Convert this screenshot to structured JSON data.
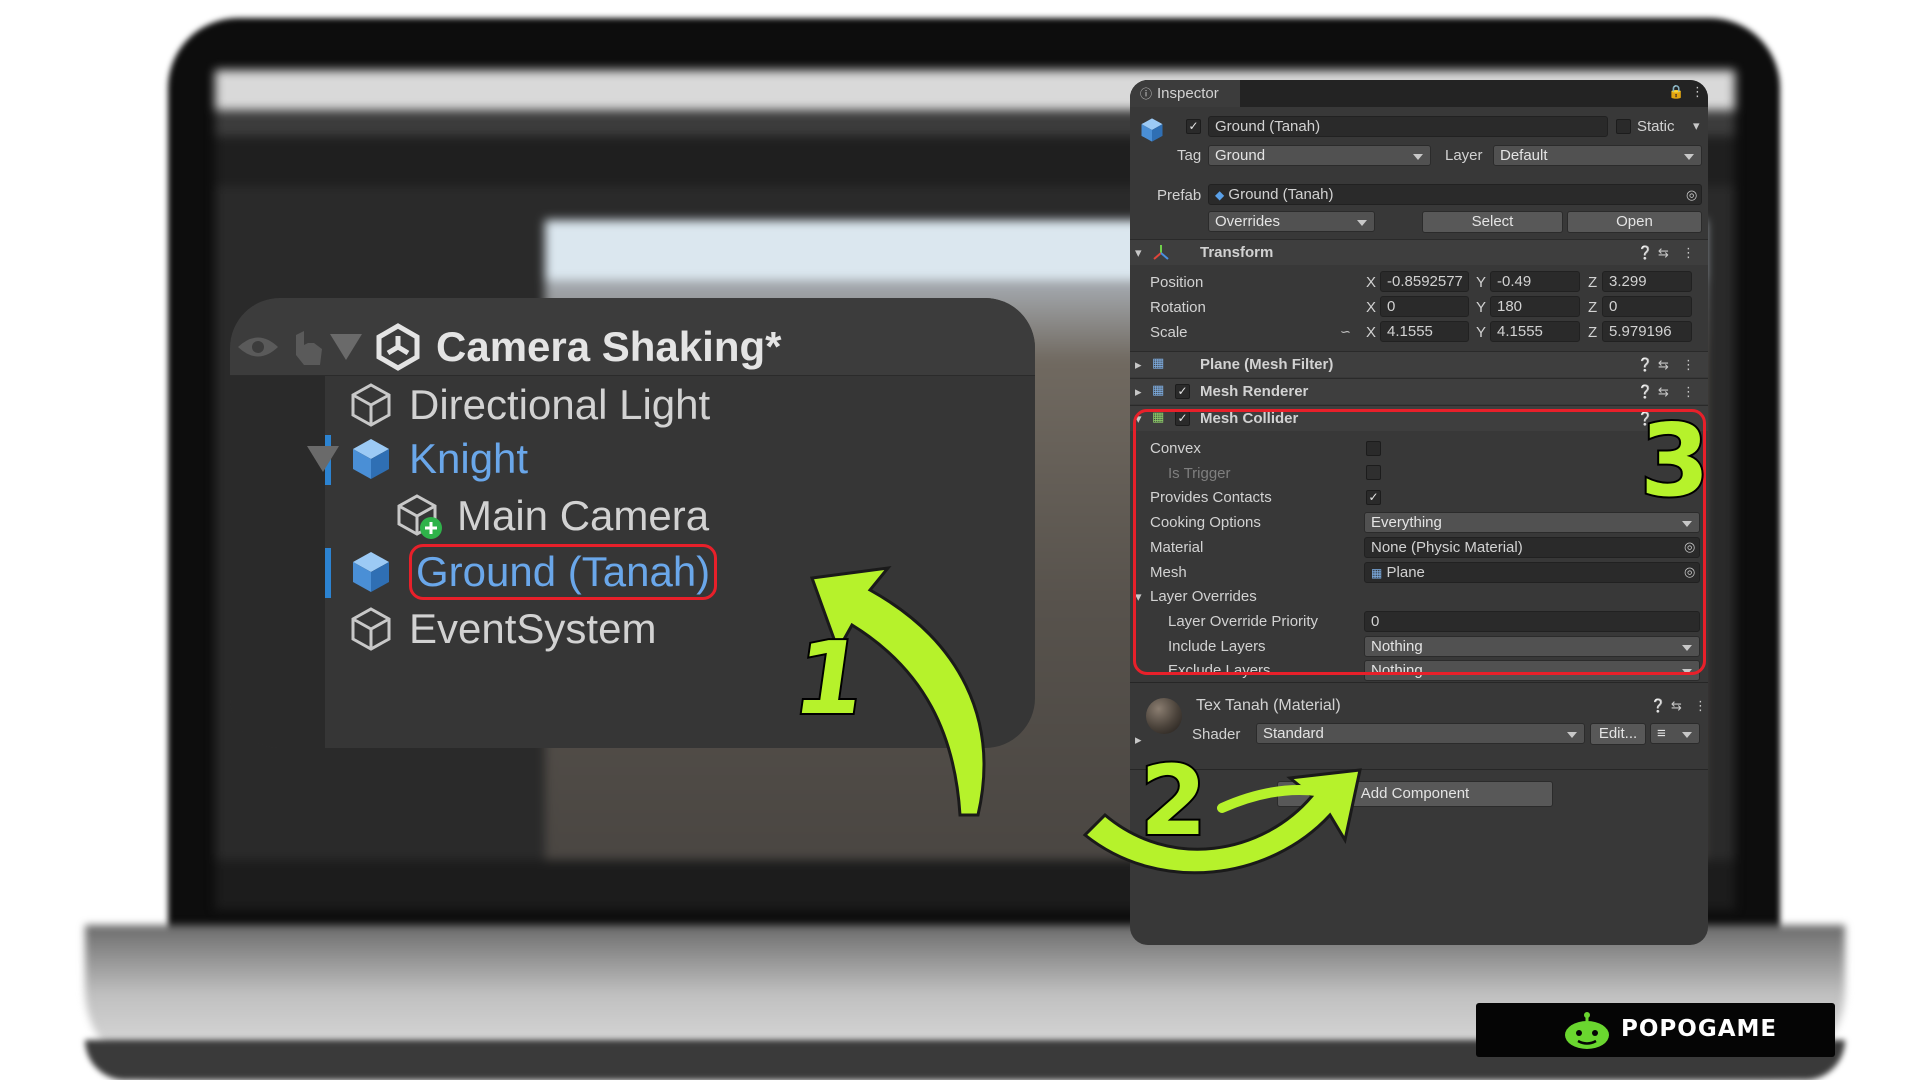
{
  "hierarchy": {
    "scene_name": "Camera Shaking*",
    "items": [
      {
        "label": "Directional Light"
      },
      {
        "label": "Knight"
      },
      {
        "label": "Main Camera"
      },
      {
        "label": "Ground (Tanah)"
      },
      {
        "label": "EventSystem"
      }
    ]
  },
  "inspector": {
    "tab_label": "Inspector",
    "object_name": "Ground (Tanah)",
    "static_label": "Static",
    "tag_label": "Tag",
    "tag_value": "Ground",
    "layer_label": "Layer",
    "layer_value": "Default",
    "prefab_label": "Prefab",
    "prefab_value": "Ground (Tanah)",
    "overrides_label": "Overrides",
    "select_label": "Select",
    "open_label": "Open",
    "transform": {
      "title": "Transform",
      "position_label": "Position",
      "rotation_label": "Rotation",
      "scale_label": "Scale",
      "position": {
        "x": "-0.8592577",
        "y": "-0.49",
        "z": "3.299"
      },
      "rotation": {
        "x": "0",
        "y": "180",
        "z": "0"
      },
      "scale": {
        "x": "4.1555",
        "y": "4.1555",
        "z": "5.979196"
      }
    },
    "mesh_filter_title": "Plane (Mesh Filter)",
    "mesh_renderer_title": "Mesh Renderer",
    "mesh_collider": {
      "title": "Mesh Collider",
      "convex_label": "Convex",
      "is_trigger_label": "Is Trigger",
      "provides_contacts_label": "Provides Contacts",
      "cooking_options_label": "Cooking Options",
      "cooking_options_value": "Everything",
      "material_label": "Material",
      "material_value": "None (Physic Material)",
      "mesh_label": "Mesh",
      "mesh_value": "Plane",
      "layer_overrides_label": "Layer Overrides",
      "layer_override_priority_label": "Layer Override Priority",
      "layer_override_priority_value": "0",
      "include_layers_label": "Include Layers",
      "include_layers_value": "Nothing",
      "exclude_layers_label": "Exclude Layers",
      "exclude_layers_value": "Nothing"
    },
    "material": {
      "title": "Tex Tanah (Material)",
      "shader_label": "Shader",
      "shader_value": "Standard",
      "edit_label": "Edit..."
    },
    "add_component_label": "Add Component"
  },
  "annotations": {
    "step1": "1",
    "step2": "2",
    "step3": "3"
  },
  "logo": {
    "brand": "POPOGAME"
  },
  "colors": {
    "accent_green": "#b6f22b",
    "highlight_red": "#e8202a",
    "unity_blue": "#6aa7ea"
  }
}
